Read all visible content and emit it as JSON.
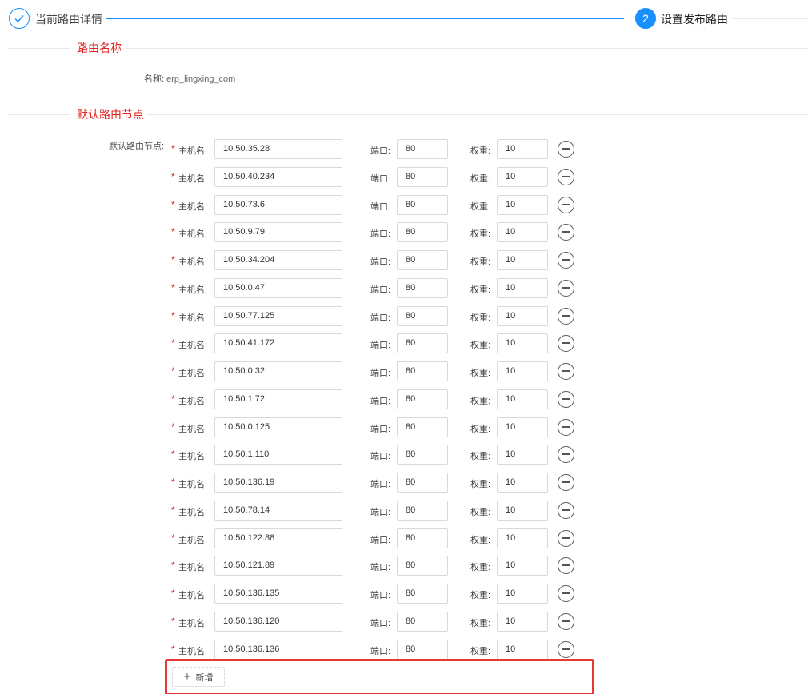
{
  "steps": [
    {
      "title": "当前路由详情",
      "status": "finished",
      "icon": "check-icon"
    },
    {
      "number": "2",
      "title": "设置发布路由",
      "status": "current"
    }
  ],
  "route_name_section": {
    "title": "路由名称",
    "name_label": "名称:",
    "name_value": "erp_lingxing_com"
  },
  "nodes_section": {
    "title": "默认路由节点",
    "label": "默认路由节点:",
    "required_mark": "*",
    "host_label": "主机名:",
    "port_label": "端口:",
    "weight_label": "权重:",
    "nodes": [
      {
        "host": "10.50.35.28",
        "port": "80",
        "weight": "10"
      },
      {
        "host": "10.50.40.234",
        "port": "80",
        "weight": "10"
      },
      {
        "host": "10.50.73.6",
        "port": "80",
        "weight": "10"
      },
      {
        "host": "10.50.9.79",
        "port": "80",
        "weight": "10"
      },
      {
        "host": "10.50.34.204",
        "port": "80",
        "weight": "10"
      },
      {
        "host": "10.50.0.47",
        "port": "80",
        "weight": "10"
      },
      {
        "host": "10.50.77.125",
        "port": "80",
        "weight": "10"
      },
      {
        "host": "10.50.41.172",
        "port": "80",
        "weight": "10"
      },
      {
        "host": "10.50.0.32",
        "port": "80",
        "weight": "10"
      },
      {
        "host": "10.50.1.72",
        "port": "80",
        "weight": "10"
      },
      {
        "host": "10.50.0.125",
        "port": "80",
        "weight": "10"
      },
      {
        "host": "10.50.1.110",
        "port": "80",
        "weight": "10"
      },
      {
        "host": "10.50.136.19",
        "port": "80",
        "weight": "10"
      },
      {
        "host": "10.50.78.14",
        "port": "80",
        "weight": "10"
      },
      {
        "host": "10.50.122.88",
        "port": "80",
        "weight": "10"
      },
      {
        "host": "10.50.121.89",
        "port": "80",
        "weight": "10"
      },
      {
        "host": "10.50.136.135",
        "port": "80",
        "weight": "10"
      },
      {
        "host": "10.50.136.120",
        "port": "80",
        "weight": "10"
      },
      {
        "host": "10.50.136.136",
        "port": "80",
        "weight": "10"
      }
    ],
    "add_button": {
      "icon": "plus-icon",
      "label": "新增"
    }
  },
  "colors": {
    "accent": "#1890ff",
    "section_title": "#e0221e",
    "highlight_frame": "#e53935"
  }
}
